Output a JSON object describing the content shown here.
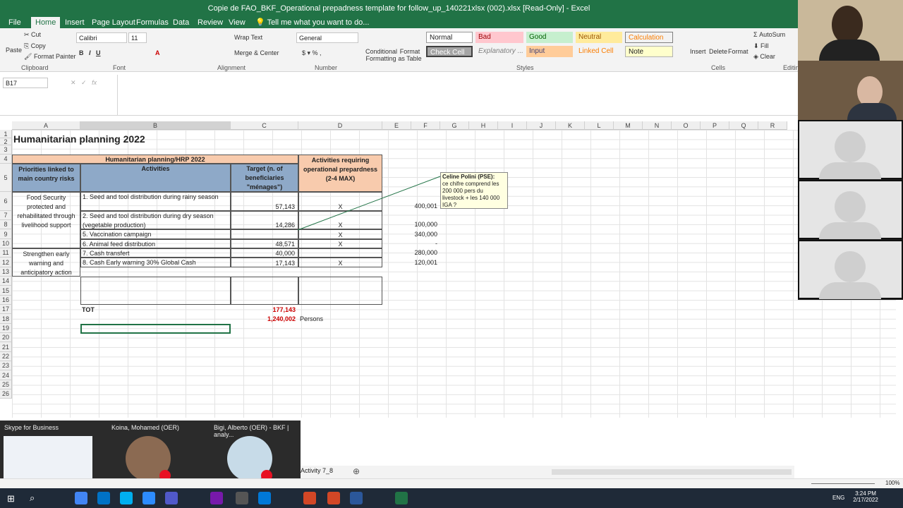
{
  "window": {
    "title": "Copie de FAO_BKF_Operational prepadness template for follow_up_140221xlsx (002).xlsx [Read-Only] - Excel"
  },
  "ribbon_tabs": [
    "File",
    "Home",
    "Insert",
    "Page Layout",
    "Formulas",
    "Data",
    "Review",
    "View"
  ],
  "tell_me": "Tell me what you want to do...",
  "clipboard": {
    "paste": "Paste",
    "cut": "Cut",
    "copy": "Copy",
    "format_painter": "Format Painter",
    "label": "Clipboard"
  },
  "font": {
    "name": "Calibri",
    "size": "11",
    "label": "Font"
  },
  "alignment": {
    "wrap": "Wrap Text",
    "merge": "Merge & Center",
    "label": "Alignment"
  },
  "number": {
    "format": "General",
    "label": "Number"
  },
  "styles": {
    "conditional": "Conditional Formatting",
    "format_table": "Format as Table",
    "label": "Styles",
    "items": [
      "Normal",
      "Bad",
      "Good",
      "Neutral",
      "Calculation",
      "Check Cell",
      "Explanatory ...",
      "Input",
      "Linked Cell",
      "Note"
    ]
  },
  "cells": {
    "insert": "Insert",
    "delete": "Delete",
    "format": "Format",
    "label": "Cells"
  },
  "editing": {
    "autosum": "AutoSum",
    "fill": "Fill",
    "clear": "Clear",
    "label": "Editing"
  },
  "namebox": "B17",
  "columns": [
    "A",
    "B",
    "C",
    "D",
    "E",
    "F",
    "G",
    "H",
    "I",
    "J",
    "K",
    "L",
    "M",
    "N",
    "O",
    "P",
    "Q",
    "R"
  ],
  "sheet": {
    "title": "Humanitarian planning 2022",
    "header_merged": "Humanitarian planning/HRP 2022",
    "col_priorities": "Priorities linked to main country risks",
    "col_activities": "Activities",
    "col_target": "Target (n. of beneficiaries \"ménages\")",
    "col_prep": "Activities requiring operational prepardness (2-4 MAX)",
    "priority1": "Food Security protected and rehabilitated through livelihood support",
    "priority2": "Strengthen early warning and anticipatory action",
    "rows": [
      {
        "act": "1. Seed and tool distribution during rainy season",
        "target": "57,143",
        "x": "X",
        "f": "400,001"
      },
      {
        "act": "2. Seed and tool distribution during dry season (vegetable production)",
        "target": "14,286",
        "x": "X",
        "f": "100,000"
      },
      {
        "act": "5. Vaccination campaign",
        "target": "",
        "x": "X",
        "f": "340,000"
      },
      {
        "act": "6. Animal feed distribution",
        "target": "48,571",
        "x": "X",
        "f": "-"
      },
      {
        "act": "7. Cash transfert",
        "target": "40,000",
        "x": "",
        "f": "280,000"
      },
      {
        "act": "8. Cash Early warning  30% Global Cash",
        "target": "17,143",
        "x": "X",
        "f": "120,001"
      }
    ],
    "tot_label": "TOT",
    "tot": "177,143",
    "total2": "1,240,002",
    "persons": "Persons"
  },
  "comment": {
    "author": "Celine Polini (PSE):",
    "text": "ce chifre comprend les 200 000 pers du livestock + les 140 000 IGA ?"
  },
  "skype": {
    "app": "Skype for Business",
    "p1": "Koina, Mohamed (OER)",
    "p2": "Bigi, Alberto (OER) - BKF | analy..."
  },
  "sheet_tab": "Activity 7_8",
  "zoom": "100%",
  "clock": {
    "time": "3:24 PM",
    "date": "2/17/2022"
  },
  "lang": "ENG"
}
